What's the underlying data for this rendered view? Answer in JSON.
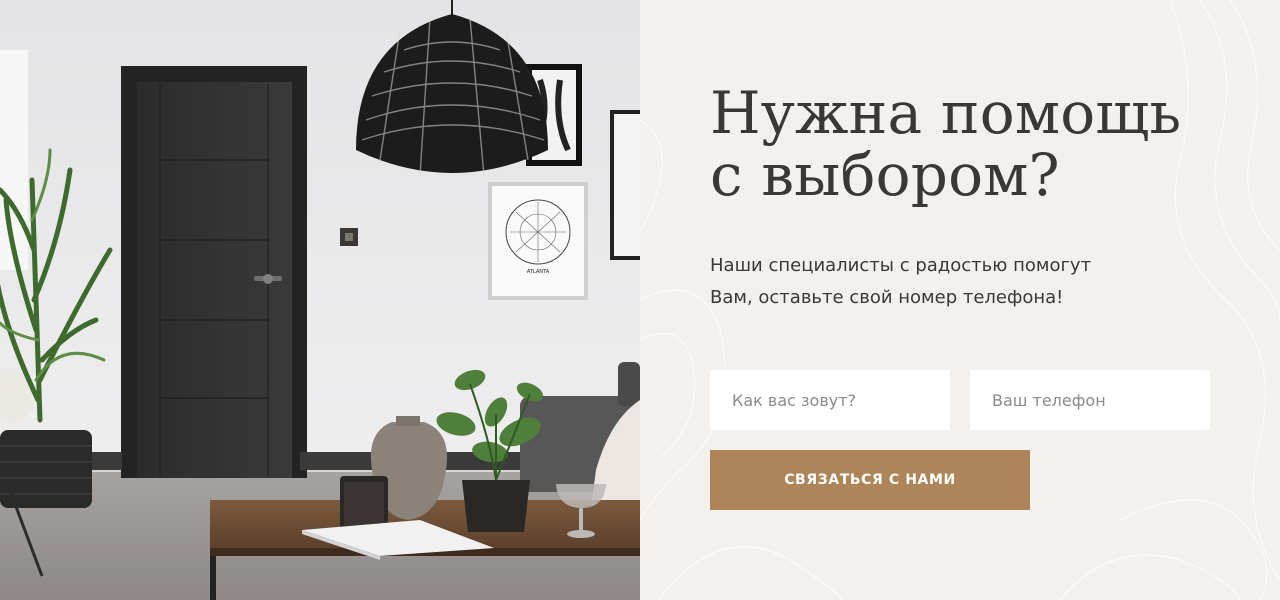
{
  "hero": {
    "title_line1": "Нужна помощь",
    "title_line2": "с выбором?",
    "description_line1": "Наши специалисты с радостью помогут",
    "description_line2": "Вам, оставьте свой номер телефона!"
  },
  "form": {
    "name_placeholder": "Как вас зовут?",
    "phone_placeholder": "Ваш телефон",
    "submit_label": "СВЯЗАТЬСЯ С НАМИ"
  },
  "illustration": {
    "poster_label": "ATLANTA"
  },
  "colors": {
    "accent": "#ad8558",
    "panel_background": "#f3f0ed",
    "text": "#3a3836"
  }
}
